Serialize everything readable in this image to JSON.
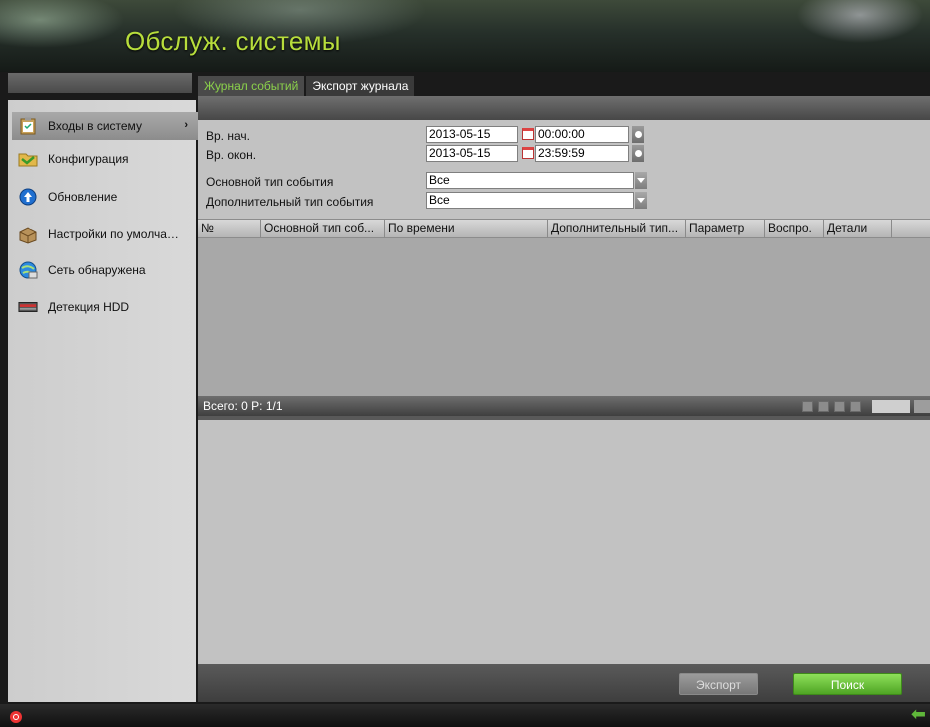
{
  "header": {
    "title": "Обслуж. системы"
  },
  "sidebar": {
    "items": [
      {
        "label": "Входы в систему",
        "icon": "clipboard-icon",
        "active": true
      },
      {
        "label": "Конфигурация",
        "icon": "folder-icon",
        "active": false
      },
      {
        "label": "Обновление",
        "icon": "upload-icon",
        "active": false
      },
      {
        "label": "Настройки по умолчан...",
        "icon": "box-icon",
        "active": false
      },
      {
        "label": "Сеть обнаружена",
        "icon": "network-globe-icon",
        "active": false
      },
      {
        "label": "Детекция HDD",
        "icon": "hdd-icon",
        "active": false
      }
    ]
  },
  "tabs": [
    {
      "label": "Журнал событий",
      "active": true
    },
    {
      "label": "Экспорт журнала",
      "active": false
    }
  ],
  "form": {
    "start_label": "Вр. нач.",
    "start_date": "2013-05-15",
    "start_time": "00:00:00",
    "end_label": "Вр. окон.",
    "end_date": "2013-05-15",
    "end_time": "23:59:59",
    "main_type_label": "Основной тип события",
    "main_type_value": "Все",
    "sub_type_label": "Дополнительный тип события",
    "sub_type_value": "Все"
  },
  "table": {
    "columns": [
      "№",
      "Основной тип соб...",
      "По времени",
      "Дополнительный тип...",
      "Параметр",
      "Воспро.",
      "Детали"
    ],
    "rows": []
  },
  "pager": {
    "text": "Всего: 0  P: 1/1"
  },
  "buttons": {
    "export": "Экспорт",
    "search": "Поиск"
  },
  "colors": {
    "accent_green": "#8bd14b",
    "title_green": "#b7dd3c",
    "search_button": "#5cb52e"
  }
}
